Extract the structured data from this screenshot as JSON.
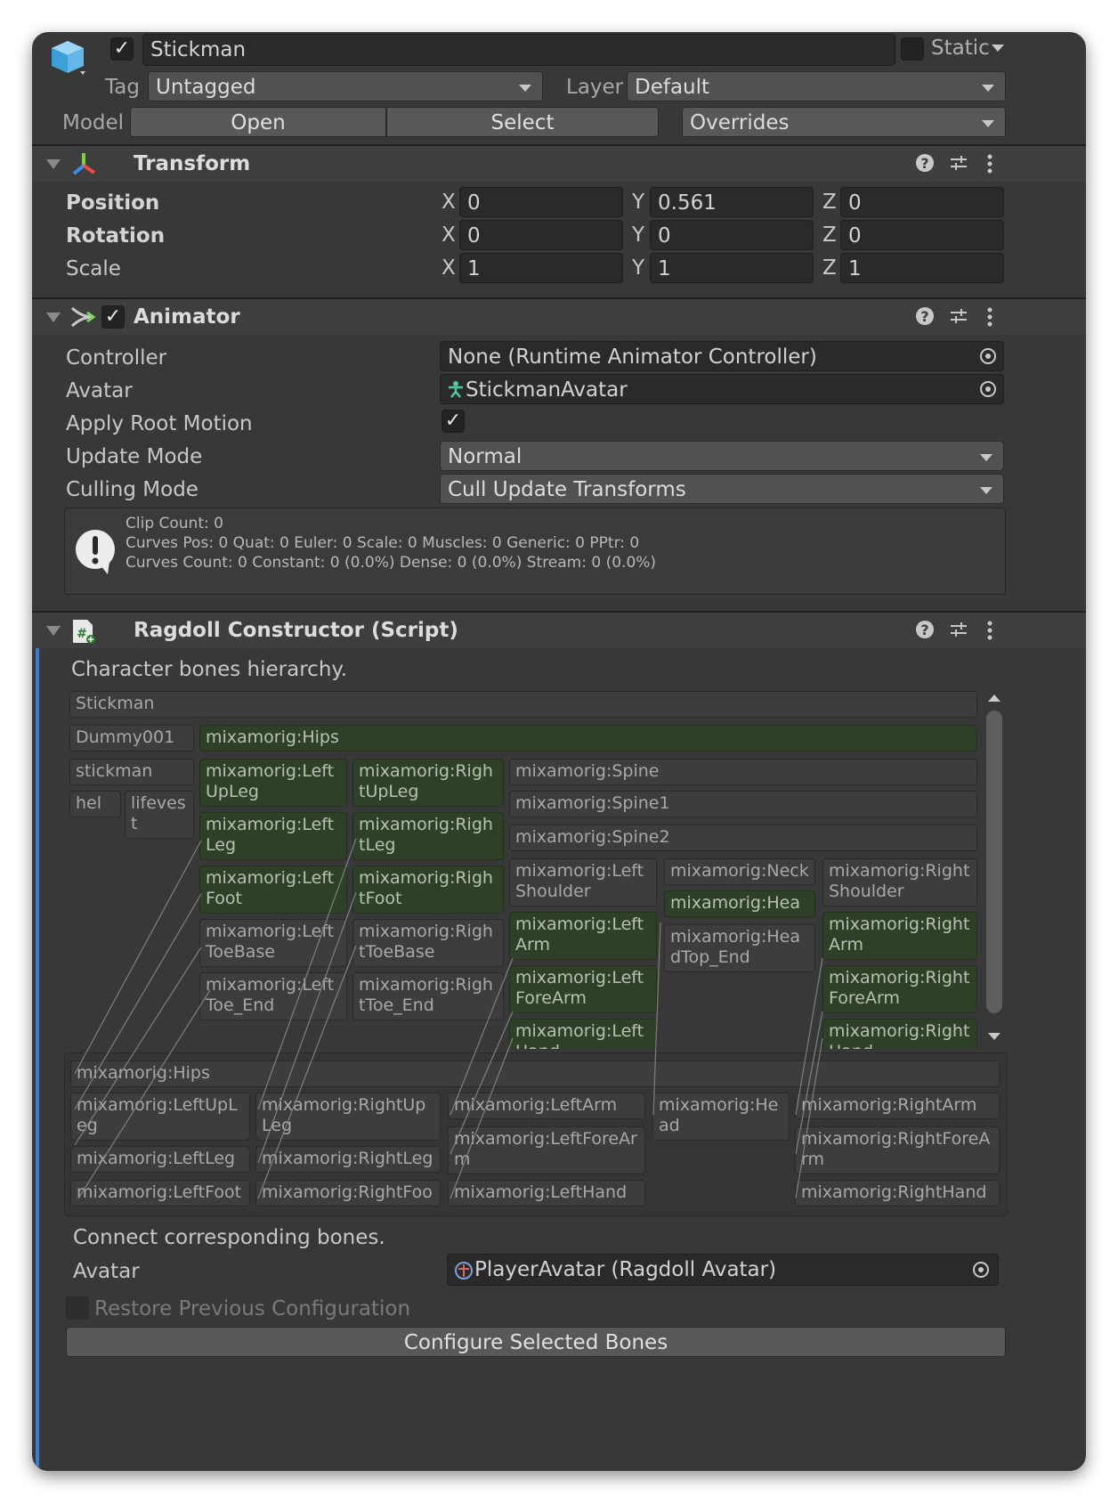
{
  "header": {
    "name": "Stickman",
    "static_label": "Static",
    "tag_label": "Tag",
    "tag_value": "Untagged",
    "layer_label": "Layer",
    "layer_value": "Default",
    "model_label": "Model",
    "open_label": "Open",
    "select_label": "Select",
    "overrides_label": "Overrides"
  },
  "transform": {
    "title": "Transform",
    "position_label": "Position",
    "rotation_label": "Rotation",
    "scale_label": "Scale",
    "axis_x": "X",
    "axis_y": "Y",
    "axis_z": "Z",
    "position": [
      "0",
      "0.561",
      "0"
    ],
    "rotation": [
      "0",
      "0",
      "0"
    ],
    "scale": [
      "1",
      "1",
      "1"
    ]
  },
  "animator": {
    "title": "Animator",
    "controller_label": "Controller",
    "controller_value": "None (Runtime Animator Controller)",
    "avatar_label": "Avatar",
    "avatar_value": "StickmanAvatar",
    "apply_root_motion_label": "Apply Root Motion",
    "update_mode_label": "Update Mode",
    "update_mode_value": "Normal",
    "culling_mode_label": "Culling Mode",
    "culling_mode_value": "Cull Update Transforms",
    "info_lines": [
      "Clip Count: 0",
      "Curves Pos: 0 Quat: 0 Euler: 0 Scale: 0 Muscles: 0 Generic: 0 PPtr: 0",
      "Curves Count: 0 Constant: 0 (0.0%) Dense: 0 (0.0%) Stream: 0 (0.0%)"
    ]
  },
  "ragdoll": {
    "title": "Ragdoll Constructor (Script)",
    "hierarchy_caption": "Character bones hierarchy.",
    "connect_caption": "Connect corresponding bones.",
    "avatar_label": "Avatar",
    "avatar_value": "PlayerAvatar (Ragdoll Avatar)",
    "restore_label": "Restore Previous Configuration",
    "configure_label": "Configure Selected Bones",
    "hierarchy": {
      "stickman": "Stickman",
      "dummy": "Dummy001",
      "stickman_lower": "stickman",
      "helm": "helm",
      "lifevest": "lifevest",
      "hips": "mixamorig:Hips",
      "left_up_leg": "mixamorig:LeftUpLeg",
      "right_up_leg": "mixamorig:RightUpLeg",
      "spine": "mixamorig:Spine",
      "spine1": "mixamorig:Spine1",
      "spine2": "mixamorig:Spine2",
      "left_leg": "mixamorig:LeftLeg",
      "right_leg": "mixamorig:RightLeg",
      "left_foot": "mixamorig:LeftFoot",
      "right_foot": "mixamorig:RightFoot",
      "left_toe_base": "mixamorig:LeftToeBase",
      "right_toe_base": "mixamorig:RightToeBase",
      "left_toe_end": "mixamorig:LeftToe_End",
      "right_toe_end": "mixamorig:RightToe_End",
      "left_shoulder": "mixamorig:LeftShoulder",
      "neck": "mixamorig:Neck",
      "right_shoulder": "mixamorig:RightShoulder",
      "head": "mixamorig:Head",
      "head_top_end": "mixamorig:HeadTop_End",
      "left_arm": "mixamorig:LeftArm",
      "right_arm": "mixamorig:RightArm",
      "left_fore_arm": "mixamorig:LeftForeArm",
      "right_fore_arm": "mixamorig:RightForeArm",
      "left_hand": "mixamorig:LeftHand",
      "right_hand": "mixamorig:RightHand"
    },
    "ragdoll_bones": {
      "hips": "mixamorig:Hips",
      "left_up_leg": "mixamorig:LeftUpLeg",
      "right_up_leg": "mixamorig:RightUpLeg",
      "left_arm": "mixamorig:LeftArm",
      "head": "mixamorig:Head",
      "right_arm": "mixamorig:RightArm",
      "left_leg": "mixamorig:LeftLeg",
      "right_leg": "mixamorig:RightLeg",
      "left_fore_arm": "mixamorig:LeftForeArm",
      "right_fore_arm": "mixamorig:RightForeArm",
      "left_foot": "mixamorig:LeftFoot",
      "right_foot": "mixamorig:RightFoot",
      "left_hand": "mixamorig:LeftHand",
      "right_hand": "mixamorig:RightHand"
    }
  },
  "colors": {
    "panel": "#383838",
    "field": "#2a2a2a",
    "selected_bone": "#2f4028",
    "accent_bar": "#3a79d6"
  },
  "icons": {
    "prefab": "prefab-cube-icon",
    "transform": "transform-axes-icon",
    "animator": "animator-icon",
    "script": "csharp-script-icon",
    "help": "help-icon",
    "presets": "presets-icon",
    "menu": "kebab-menu-icon",
    "object_picker": "object-picker-icon",
    "warning": "warning-icon"
  }
}
